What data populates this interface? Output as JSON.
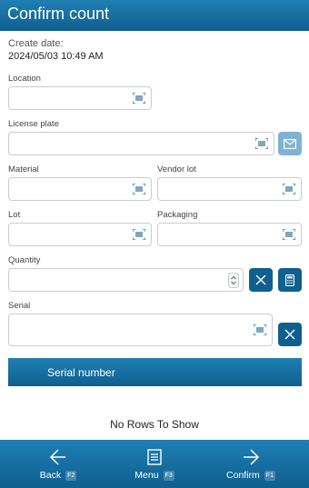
{
  "header": {
    "title": "Confirm count"
  },
  "create": {
    "label": "Create date:",
    "value": "2024/05/03 10:49 AM"
  },
  "fields": {
    "location": "Location",
    "license_plate": "License plate",
    "material": "Material",
    "vendor_lot": "Vendor lot",
    "lot": "Lot",
    "packaging": "Packaging",
    "quantity": "Quantity",
    "serial": "Serial"
  },
  "table": {
    "column": "Serial number",
    "empty": "No Rows To Show"
  },
  "footer": {
    "back": {
      "label": "Back",
      "key": "F2"
    },
    "menu": {
      "label": "Menu",
      "key": "F3"
    },
    "confirm": {
      "label": "Confirm",
      "key": "F1"
    }
  },
  "colors": {
    "primary": "#0f5f8f",
    "primary_light": "#7fb3d3",
    "border": "#c9ccd0"
  },
  "icons": [
    "barcode-scan-icon",
    "envelope-icon",
    "close-icon",
    "calculator-icon",
    "arrow-left-icon",
    "menu-icon",
    "arrow-right-icon"
  ]
}
